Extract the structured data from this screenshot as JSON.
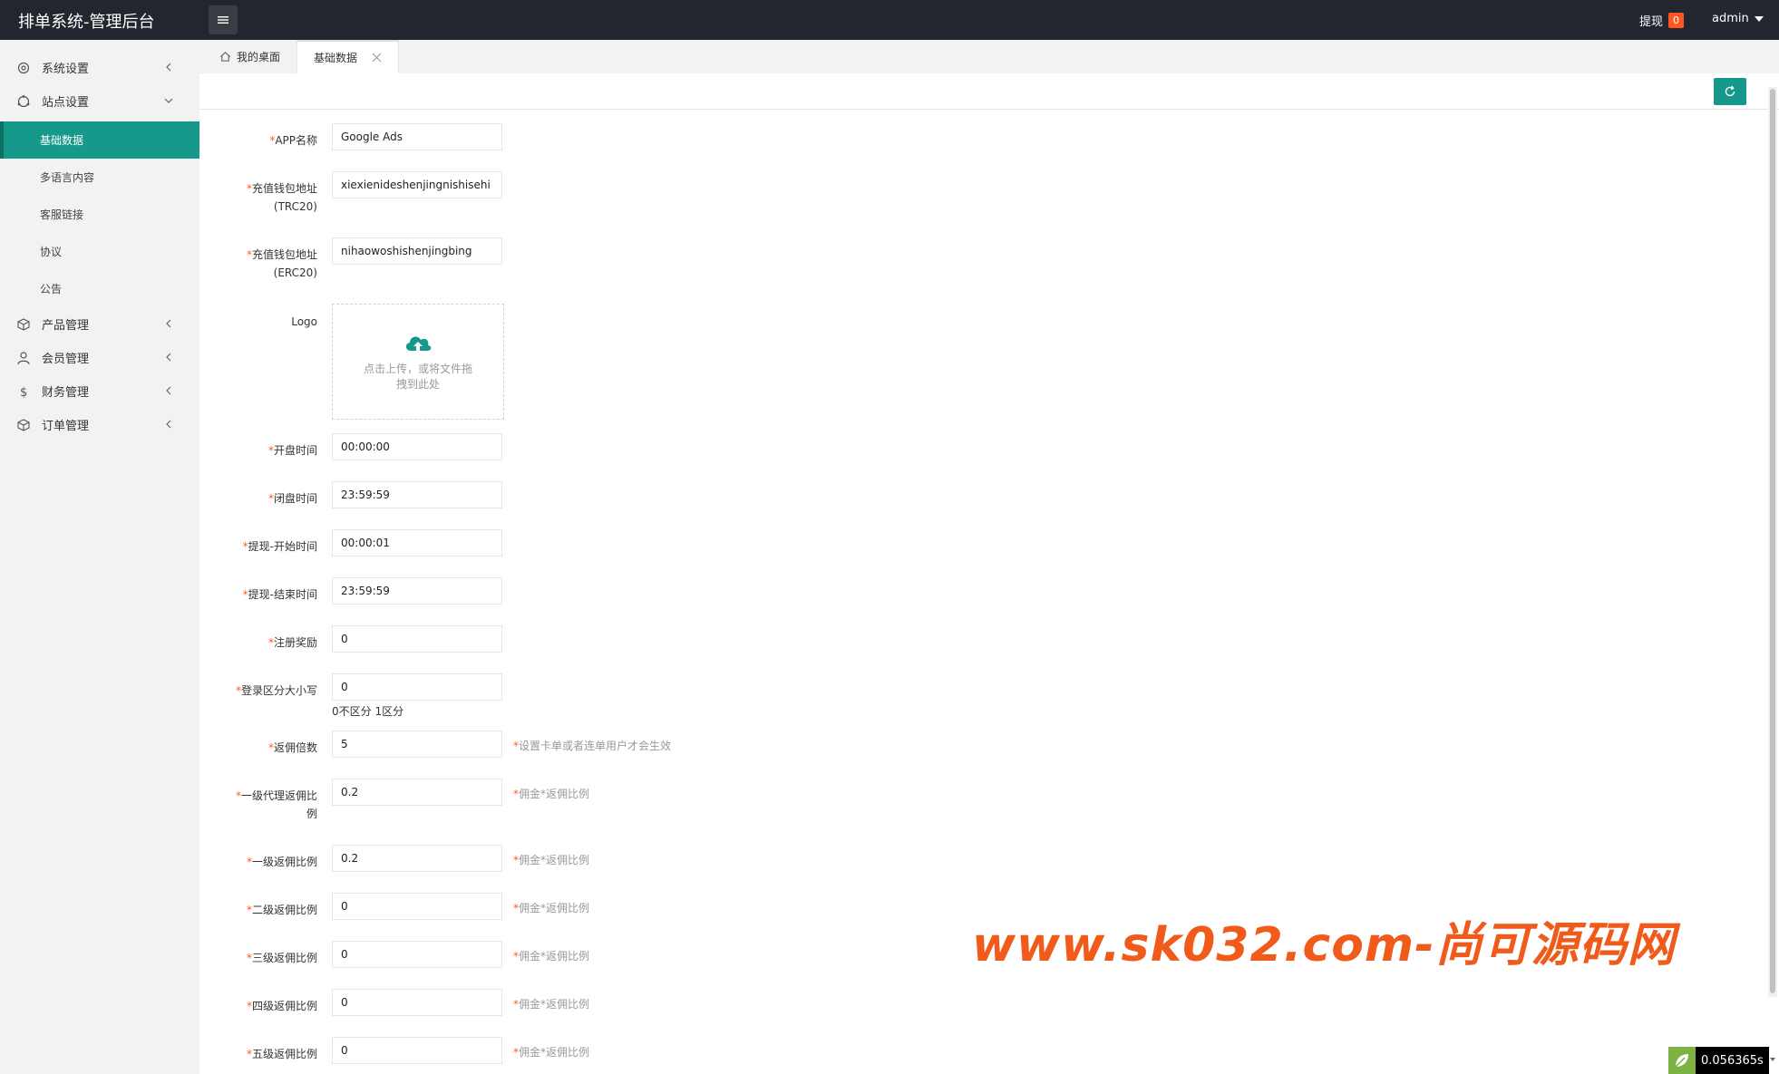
{
  "header": {
    "title": "排单系统-管理后台",
    "withdraw_label": "提现",
    "withdraw_count": "0",
    "user": "admin"
  },
  "sidebar": {
    "items": [
      {
        "label": "系统设置",
        "icon": "gear-icon"
      },
      {
        "label": "站点设置",
        "icon": "site-icon",
        "expanded": true,
        "children": [
          {
            "label": "基础数据",
            "active": true
          },
          {
            "label": "多语言内容"
          },
          {
            "label": "客服链接"
          },
          {
            "label": "协议"
          },
          {
            "label": "公告"
          }
        ]
      },
      {
        "label": "产品管理",
        "icon": "box-icon"
      },
      {
        "label": "会员管理",
        "icon": "user-icon"
      },
      {
        "label": "财务管理",
        "icon": "dollar-icon"
      },
      {
        "label": "订单管理",
        "icon": "box-icon"
      }
    ]
  },
  "tabs": [
    {
      "label": "我的桌面",
      "icon": "home-icon"
    },
    {
      "label": "基础数据",
      "active": true,
      "closable": true
    }
  ],
  "form": {
    "app_name": {
      "label": "APP名称",
      "value": "Google Ads"
    },
    "wallet_trc20": {
      "label_line1": "充值钱包地址",
      "label_line2": "(TRC20)",
      "value": "xiexienideshenjingnishisehi"
    },
    "wallet_erc20": {
      "label_line1": "充值钱包地址",
      "label_line2": "(ERC20)",
      "value": "nihaowoshishenjingbing"
    },
    "logo": {
      "label": "Logo",
      "upload_text": "点击上传，或将文件拖拽到此处"
    },
    "open_time": {
      "label": "开盘时间",
      "value": "00:00:00"
    },
    "close_time": {
      "label": "闭盘时间",
      "value": "23:59:59"
    },
    "withdraw_start": {
      "label": "提现-开始时间",
      "value": "00:00:01"
    },
    "withdraw_end": {
      "label": "提现-结束时间",
      "value": "23:59:59"
    },
    "register_reward": {
      "label": "注册奖励",
      "value": "0"
    },
    "login_case": {
      "label": "登录区分大小写",
      "value": "0",
      "note": "0不区分 1区分"
    },
    "commission_multiple": {
      "label": "返佣倍数",
      "value": "5",
      "hint": "设置卡单或者连单用户才会生效"
    },
    "agent1_ratio": {
      "label_line1": "一级代理返佣比",
      "label_line2": "例",
      "value": "0.2",
      "hint": "佣金*返佣比例"
    },
    "level1_ratio": {
      "label": "一级返佣比例",
      "value": "0.2",
      "hint": "佣金*返佣比例"
    },
    "level2_ratio": {
      "label": "二级返佣比例",
      "value": "0",
      "hint": "佣金*返佣比例"
    },
    "level3_ratio": {
      "label": "三级返佣比例",
      "value": "0",
      "hint": "佣金*返佣比例"
    },
    "level4_ratio": {
      "label": "四级返佣比例",
      "value": "0",
      "hint": "佣金*返佣比例"
    },
    "level5_ratio": {
      "label": "五级返佣比例",
      "value": "0",
      "hint": "佣金*返佣比例"
    }
  },
  "watermark": "www.sk032.com-尚可源码网",
  "timer": "0.056365s",
  "colors": {
    "accent": "#16998a",
    "header": "#23262e",
    "badge": "#ff5722",
    "watermark": "#f05a1a"
  }
}
